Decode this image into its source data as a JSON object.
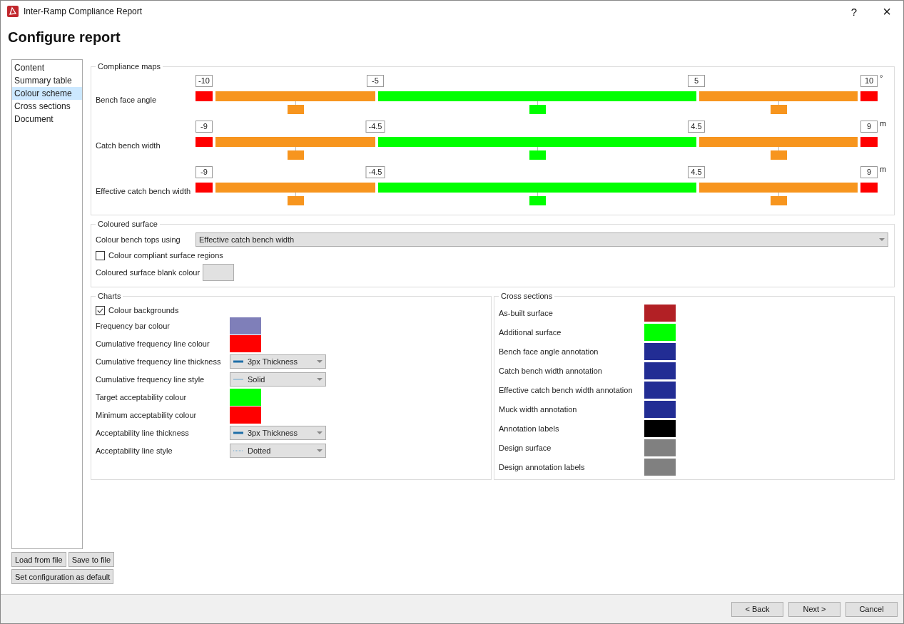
{
  "window": {
    "title": "Inter-Ramp Compliance Report",
    "help": "?",
    "close": "×"
  },
  "heading": "Configure report",
  "nav": [
    {
      "label": "Content",
      "selected": false
    },
    {
      "label": "Summary table",
      "selected": false
    },
    {
      "label": "Colour scheme",
      "selected": true
    },
    {
      "label": "Cross sections",
      "selected": false
    },
    {
      "label": "Document",
      "selected": false
    }
  ],
  "compliance_maps": {
    "title": "Compliance maps",
    "rows": [
      {
        "label": "Bench face angle",
        "unit": "°",
        "thresholds": [
          "-10",
          "-5",
          "5",
          "10"
        ],
        "segments": [
          {
            "kind": "end",
            "color": "#ff0000"
          },
          {
            "kind": "band",
            "color": "#f7951e"
          },
          {
            "kind": "band",
            "color": "#00ff00"
          },
          {
            "kind": "band",
            "color": "#f7951e"
          },
          {
            "kind": "end",
            "color": "#ff0000"
          }
        ]
      },
      {
        "label": "Catch bench width",
        "unit": "m",
        "thresholds": [
          "-9",
          "-4.5",
          "4.5",
          "9"
        ],
        "segments": [
          {
            "kind": "end",
            "color": "#ff0000"
          },
          {
            "kind": "band",
            "color": "#f7951e"
          },
          {
            "kind": "band",
            "color": "#00ff00"
          },
          {
            "kind": "band",
            "color": "#f7951e"
          },
          {
            "kind": "end",
            "color": "#ff0000"
          }
        ]
      },
      {
        "label": "Effective catch bench width",
        "unit": "m",
        "thresholds": [
          "-9",
          "-4.5",
          "4.5",
          "9"
        ],
        "segments": [
          {
            "kind": "end",
            "color": "#ff0000"
          },
          {
            "kind": "band",
            "color": "#f7951e"
          },
          {
            "kind": "band",
            "color": "#00ff00"
          },
          {
            "kind": "band",
            "color": "#f7951e"
          },
          {
            "kind": "end",
            "color": "#ff0000"
          }
        ]
      }
    ]
  },
  "coloured_surface": {
    "title": "Coloured surface",
    "rows": [
      {
        "kind": "dropdown",
        "label": "Colour bench tops using",
        "value": "Effective catch bench width"
      },
      {
        "kind": "checkbox",
        "label": "Colour compliant surface regions",
        "checked": false
      },
      {
        "kind": "colour",
        "label": "Coloured surface blank colour",
        "color": "#e1e1e1"
      }
    ]
  },
  "charts": {
    "title": "Charts",
    "rows": [
      {
        "kind": "checkbox",
        "label": "Colour backgrounds",
        "checked": true
      },
      {
        "kind": "colour",
        "label": "Frequency bar colour",
        "color": "#7f7fb9"
      },
      {
        "kind": "colour",
        "label": "Cumulative frequency line colour",
        "color": "#ff0000"
      },
      {
        "kind": "thickness",
        "label": "Cumulative frequency line thickness",
        "value": "3px Thickness"
      },
      {
        "kind": "solid",
        "label": "Cumulative frequency line style",
        "value": "Solid"
      },
      {
        "kind": "colour",
        "label": "Target acceptability colour",
        "color": "#00ff00"
      },
      {
        "kind": "colour",
        "label": "Minimum acceptability colour",
        "color": "#ff0000"
      },
      {
        "kind": "thickness",
        "label": "Acceptability line thickness",
        "value": "3px Thickness"
      },
      {
        "kind": "dotted",
        "label": "Acceptability line style",
        "value": "Dotted"
      }
    ]
  },
  "cross_sections": {
    "title": "Cross sections",
    "rows": [
      {
        "label": "As-built surface",
        "color": "#b22025"
      },
      {
        "label": "Additional surface",
        "color": "#00ff00"
      },
      {
        "label": "Bench face angle annotation",
        "color": "#222d94"
      },
      {
        "label": "Catch bench width annotation",
        "color": "#222d94"
      },
      {
        "label": "Effective catch bench width annotation",
        "color": "#222d94"
      },
      {
        "label": "Muck width annotation",
        "color": "#222d94"
      },
      {
        "label": "Annotation labels",
        "color": "#000000"
      },
      {
        "label": "Design surface",
        "color": "#808080"
      },
      {
        "label": "Design annotation labels",
        "color": "#808080"
      }
    ]
  },
  "config_buttons": [
    "Load from file",
    "Save to file",
    "Set configuration as default"
  ],
  "footer_buttons": [
    {
      "label": "< Back",
      "disabled": false
    },
    {
      "label": "Next >",
      "disabled": false
    },
    {
      "label": "Cancel",
      "disabled": false
    }
  ]
}
